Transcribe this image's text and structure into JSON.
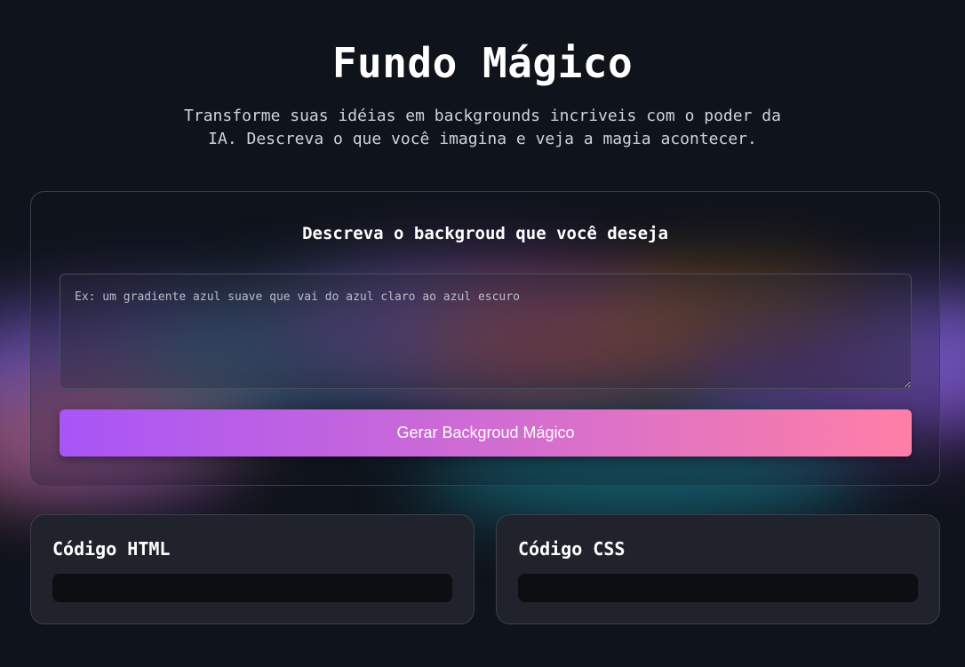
{
  "header": {
    "title": "Fundo Mágico",
    "subtitle": "Transforme suas idéias em backgrounds incriveis com o poder da IA. Descreva o que você imagina e veja a magia acontecer."
  },
  "generator": {
    "heading": "Descreva o backgroud que você deseja",
    "prompt_value": "",
    "prompt_placeholder": "Ex: um gradiente azul suave que vai do azul claro ao azul escuro",
    "button_label": "Gerar Backgroud Mágico"
  },
  "output": {
    "html_title": "Código HTML",
    "html_code": "",
    "css_title": "Código CSS",
    "css_code": ""
  },
  "colors": {
    "background": "#0f131b",
    "accent_start": "#a855f7",
    "accent_end": "#ff7fa6"
  }
}
